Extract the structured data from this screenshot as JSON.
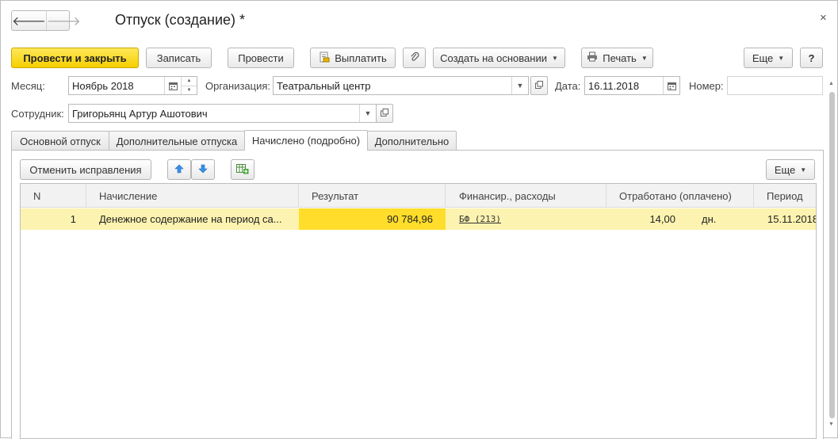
{
  "window": {
    "title": "Отпуск (создание) *",
    "close": "×",
    "nav_back": "🡐",
    "nav_forward": "🡒"
  },
  "toolbar": {
    "post_close": "Провести и закрыть",
    "save": "Записать",
    "post": "Провести",
    "pay": "Выплатить",
    "create_based": "Создать на основании",
    "print": "Печать",
    "more": "Еще",
    "help": "?"
  },
  "fields": {
    "month_label": "Месяц:",
    "month_value": "Ноябрь 2018",
    "org_label": "Организация:",
    "org_value": "Театральный центр",
    "date_label": "Дата:",
    "date_value": "16.11.2018",
    "number_label": "Номер:",
    "number_value": "",
    "employee_label": "Сотрудник:",
    "employee_value": "Григорьянц Артур Ашотович"
  },
  "tabs": [
    "Основной отпуск",
    "Дополнительные отпуска",
    "Начислено (подробно)",
    "Дополнительно"
  ],
  "panel": {
    "cancel_fix": "Отменить исправления",
    "more": "Еще"
  },
  "table": {
    "columns": [
      "N",
      "Начисление",
      "Результат",
      "Финансир., расходы",
      "Отработано (оплачено)",
      "Период"
    ],
    "rows": [
      {
        "n": "1",
        "accrual": "Денежное содержание на период са...",
        "result": "90 784,96",
        "financing": "БФ (213)",
        "worked": "14,00",
        "unit": "дн.",
        "period": "15.11.2018"
      }
    ]
  },
  "colors": {
    "primary_button": "#f5cf00",
    "selected_row": "#fdf3b0",
    "selected_cell": "#ffdd2a"
  }
}
